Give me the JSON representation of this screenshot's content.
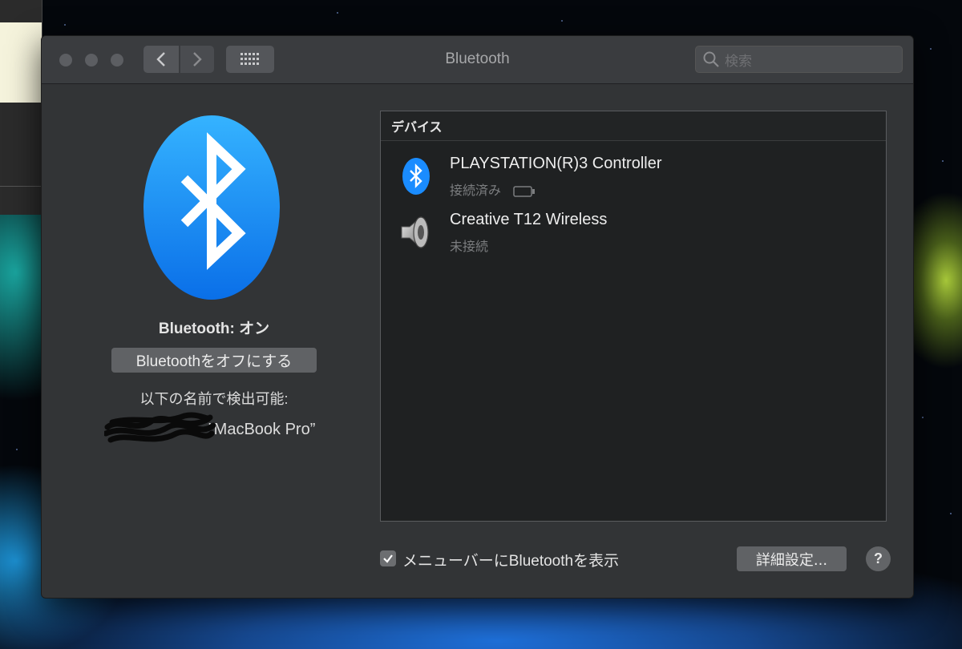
{
  "window": {
    "title": "Bluetooth",
    "search_placeholder": "検索"
  },
  "left_panel": {
    "status": "Bluetooth: オン",
    "toggle_button": "Bluetoothをオフにする",
    "discoverable_label": "以下の名前で検出可能:",
    "device_name_visible": "”MacBook Pro”"
  },
  "device_list": {
    "header": "デバイス",
    "devices": [
      {
        "name": "PLAYSTATION(R)3 Controller",
        "status": "接続済み",
        "icon": "bluetooth-icon"
      },
      {
        "name": "Creative T12 Wireless",
        "status": "未接続",
        "icon": "speaker-icon"
      }
    ]
  },
  "footer": {
    "show_in_menubar_label": "メニューバーにBluetoothを表示",
    "show_in_menubar_checked": true,
    "advanced_button": "詳細設定...",
    "help_button": "?"
  },
  "colors": {
    "accent_blue": "#1a8cff",
    "window_bg": "#323436",
    "list_bg": "#1f2122"
  }
}
